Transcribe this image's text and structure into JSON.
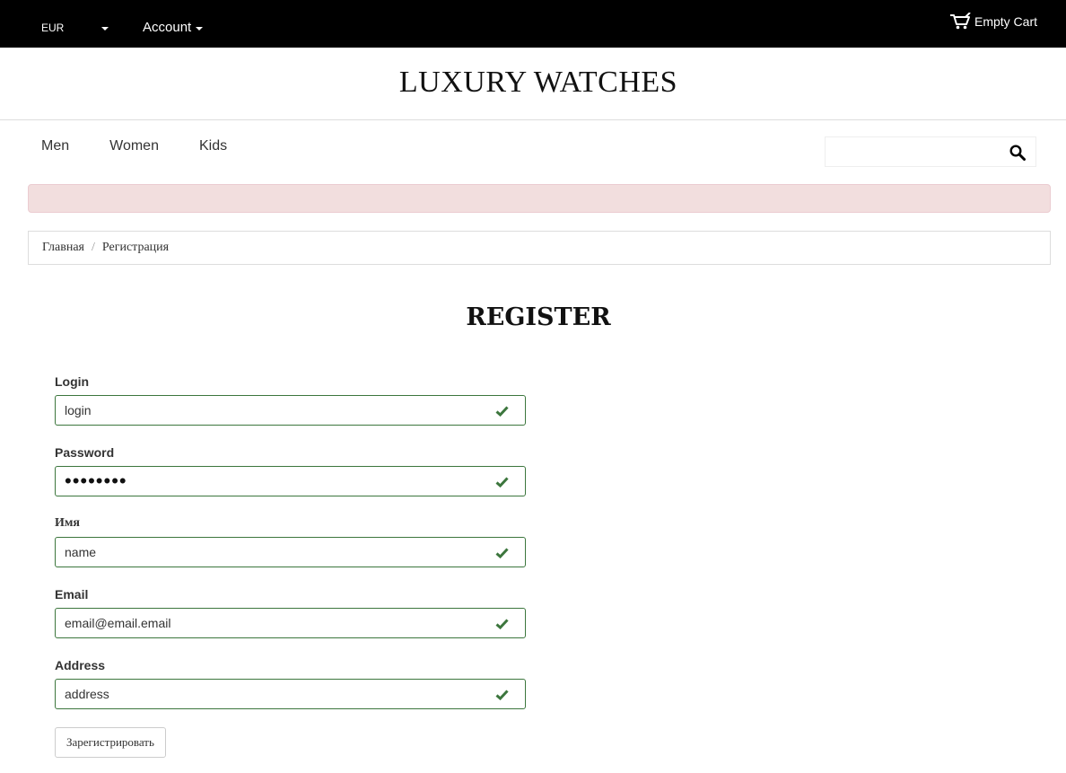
{
  "topbar": {
    "currency": "EUR",
    "account_label": "Account",
    "cart_label": "Empty Cart"
  },
  "logo": "LUXURY WATCHES",
  "nav": {
    "items": [
      {
        "label": "Men"
      },
      {
        "label": "Women"
      },
      {
        "label": "Kids"
      }
    ],
    "search_placeholder": "",
    "search_value": ""
  },
  "breadcrumb": {
    "home": "Главная",
    "separator": "/",
    "current": "Регистрация"
  },
  "heading": "REGISTER",
  "form": {
    "login_label": "Login",
    "login_value": "login",
    "password_label": "Password",
    "password_value": "password",
    "name_label": "Имя",
    "name_value": "name",
    "email_label": "Email",
    "email_value": "email@email.email",
    "address_label": "Address",
    "address_value": "address",
    "submit_label": "Зарегистрировать"
  },
  "colors": {
    "topbar": "#000000",
    "alert_bg": "#f2dede",
    "success_border": "#3c763d"
  },
  "icons": [
    "caret-down-icon",
    "cart-icon",
    "search-icon",
    "check-icon"
  ]
}
